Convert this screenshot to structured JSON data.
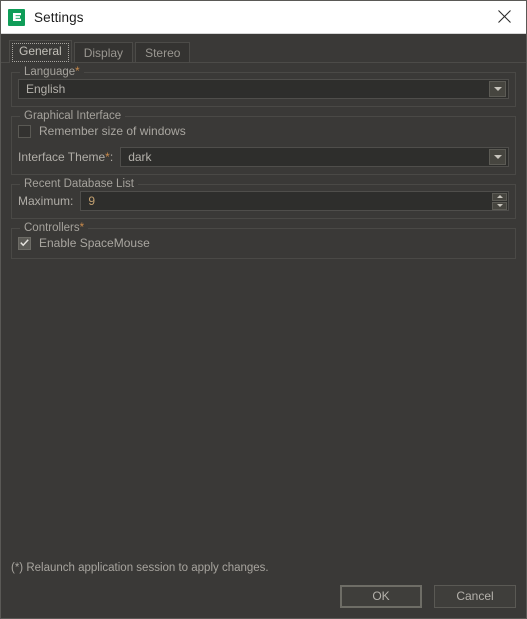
{
  "window": {
    "title": "Settings",
    "app_icon": "app-logo-e-icon",
    "close_icon": "close-icon"
  },
  "tabs": [
    {
      "label": "General",
      "active": true
    },
    {
      "label": "Display",
      "active": false
    },
    {
      "label": "Stereo",
      "active": false
    }
  ],
  "groups": {
    "language": {
      "title": "Language",
      "required_marker": "*",
      "combo": {
        "value": "English",
        "arrow_icon": "chevron-down-icon"
      }
    },
    "graphical_interface": {
      "title": "Graphical Interface",
      "remember_size": {
        "label": "Remember size of windows",
        "checked": false
      },
      "interface_theme": {
        "label": "Interface Theme",
        "required_marker": "*",
        "label_suffix": ":",
        "value": "dark",
        "arrow_icon": "chevron-down-icon"
      }
    },
    "recent_database_list": {
      "title": "Recent Database List",
      "maximum": {
        "label": "Maximum:",
        "value": "9",
        "up_icon": "triangle-up-icon",
        "down_icon": "triangle-down-icon"
      }
    },
    "controllers": {
      "title": "Controllers",
      "required_marker": "*",
      "enable_spacemouse": {
        "label": "Enable SpaceMouse",
        "checked": true
      }
    }
  },
  "footer": {
    "note": "(*) Relaunch application session to apply changes.",
    "ok_label": "OK",
    "cancel_label": "Cancel"
  },
  "colors": {
    "window_background": "#3a3937",
    "titlebar_background": "#ffffff",
    "accent_green": "#0f9d58",
    "required_marker": "#c98a4b",
    "value_text": "#b4b1ab",
    "spin_value_text": "#c2a070"
  }
}
